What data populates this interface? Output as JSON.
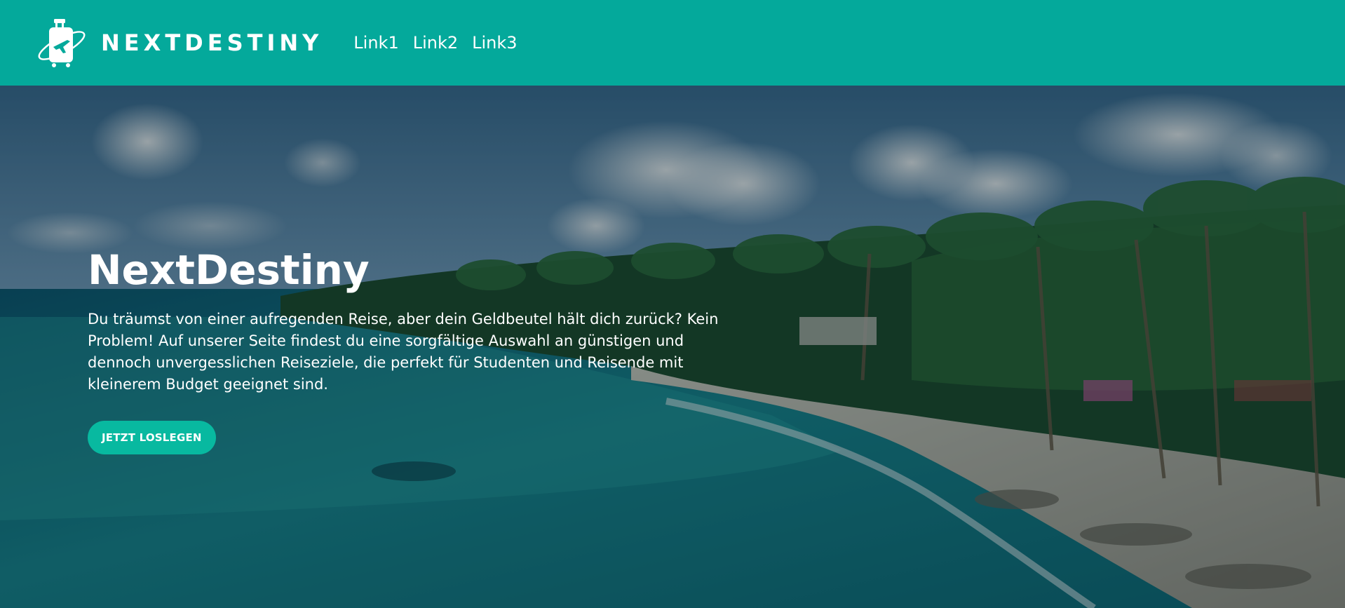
{
  "header": {
    "brand_name": "NEXTDESTINY",
    "nav_links": [
      "Link1",
      "Link2",
      "Link3"
    ]
  },
  "hero": {
    "title": "NextDestiny",
    "text": "Du träumst von einer aufregenden Reise, aber dein Geldbeutel hält dich zurück? Kein Problem! Auf unserer Seite findest du eine sorgfältige Auswahl an günstigen und dennoch unvergesslichen Reiseziele, die perfekt für Studenten und Reisende mit kleinerem Budget geeignet sind.",
    "cta_label": "JETZT LOSLEGEN"
  },
  "icons": {
    "logo": "suitcase-airplane-icon"
  },
  "colors": {
    "header_bg": "#04a99b",
    "cta_bg": "#08b9a0",
    "text": "#ffffff"
  }
}
